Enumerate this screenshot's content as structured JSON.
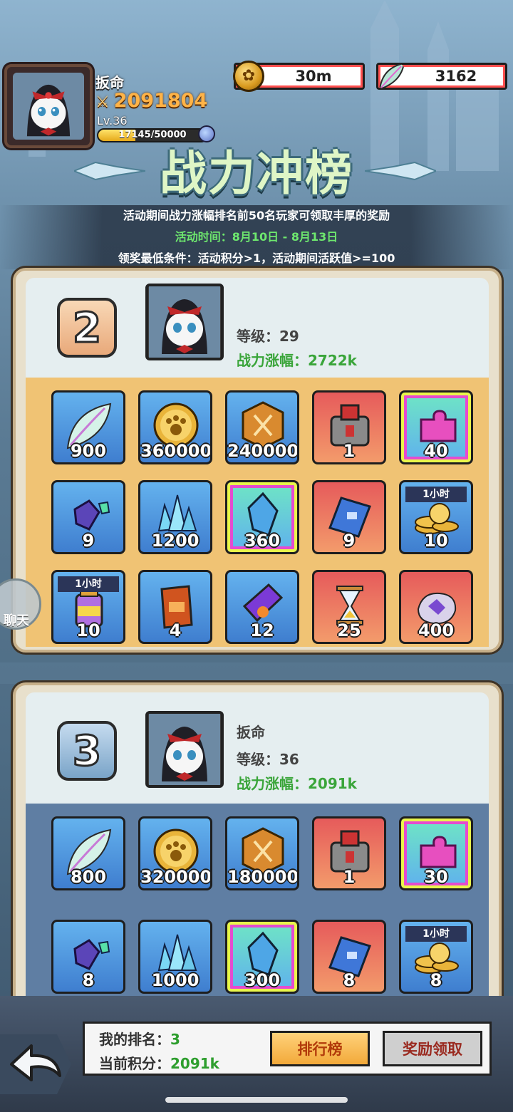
{
  "player": {
    "name": "扳命",
    "power": "2091804",
    "level": "Lv.36",
    "exp": "17145/50000",
    "exp_fraction": 0.343
  },
  "currencies": {
    "coins": "30m",
    "feathers": "3162"
  },
  "event": {
    "title": "战力冲榜",
    "desc": "活动期间战力涨幅排名前50名玩家可领取丰厚的奖励",
    "time": "活动时间：8月10日 - 8月13日",
    "condition": "领奖最低条件：活动积分>1，活动期间活跃值>=100"
  },
  "rank2": {
    "rank": "2",
    "level": "等级：29",
    "gain": "战力涨幅：2722k",
    "items": [
      {
        "icon": "feather-icon",
        "qty": "900",
        "bg": "blue-bg"
      },
      {
        "icon": "paw-coin-icon",
        "qty": "360000",
        "bg": "blue-bg"
      },
      {
        "icon": "sword-medal-icon",
        "qty": "240000",
        "bg": "blue-bg"
      },
      {
        "icon": "treasure-chest-icon",
        "qty": "1",
        "bg": "red-bg"
      },
      {
        "icon": "puzzle-piece-icon",
        "qty": "40",
        "bg": "rainbow"
      },
      {
        "icon": "gems-icon",
        "qty": "9",
        "bg": "blue-bg"
      },
      {
        "icon": "crystal-cluster-icon",
        "qty": "1200",
        "bg": "blue-bg"
      },
      {
        "icon": "blue-crystal-icon",
        "qty": "360",
        "bg": "rainbow"
      },
      {
        "icon": "blueprint-icon",
        "qty": "9",
        "bg": "red-bg"
      },
      {
        "icon": "coin-stack-icon",
        "qty": "10",
        "bg": "blue-bg",
        "tag": "1小时"
      },
      {
        "icon": "potion-jar-icon",
        "qty": "10",
        "bg": "blue-bg",
        "tag": "1小时"
      },
      {
        "icon": "red-ticket-icon",
        "qty": "4",
        "bg": "blue-bg"
      },
      {
        "icon": "purple-ticket-icon",
        "qty": "12",
        "bg": "blue-bg"
      },
      {
        "icon": "hourglass-icon",
        "qty": "25",
        "bg": "red-bg"
      },
      {
        "icon": "magic-dust-icon",
        "qty": "400",
        "bg": "red-bg"
      }
    ]
  },
  "rank3": {
    "rank": "3",
    "name": "扳命",
    "level": "等级：36",
    "gain": "战力涨幅：2091k",
    "items": [
      {
        "icon": "feather-icon",
        "qty": "800",
        "bg": "blue-bg"
      },
      {
        "icon": "paw-coin-icon",
        "qty": "320000",
        "bg": "blue-bg"
      },
      {
        "icon": "sword-medal-icon",
        "qty": "180000",
        "bg": "blue-bg"
      },
      {
        "icon": "treasure-chest-icon",
        "qty": "1",
        "bg": "red-bg"
      },
      {
        "icon": "puzzle-piece-icon",
        "qty": "30",
        "bg": "rainbow"
      },
      {
        "icon": "gems-icon",
        "qty": "8",
        "bg": "blue-bg"
      },
      {
        "icon": "crystal-cluster-icon",
        "qty": "1000",
        "bg": "blue-bg"
      },
      {
        "icon": "blue-crystal-icon",
        "qty": "300",
        "bg": "rainbow"
      },
      {
        "icon": "blueprint-icon",
        "qty": "8",
        "bg": "red-bg"
      },
      {
        "icon": "coin-stack-icon",
        "qty": "8",
        "bg": "blue-bg",
        "tag": "1小时"
      }
    ]
  },
  "chat": {
    "label": "聊天"
  },
  "bottom": {
    "my_rank_label": "我的排名：",
    "my_rank": "3",
    "score_label": "当前积分：",
    "score": "2091k",
    "leaderboard_btn": "排行榜",
    "claim_btn": "奖励领取"
  }
}
